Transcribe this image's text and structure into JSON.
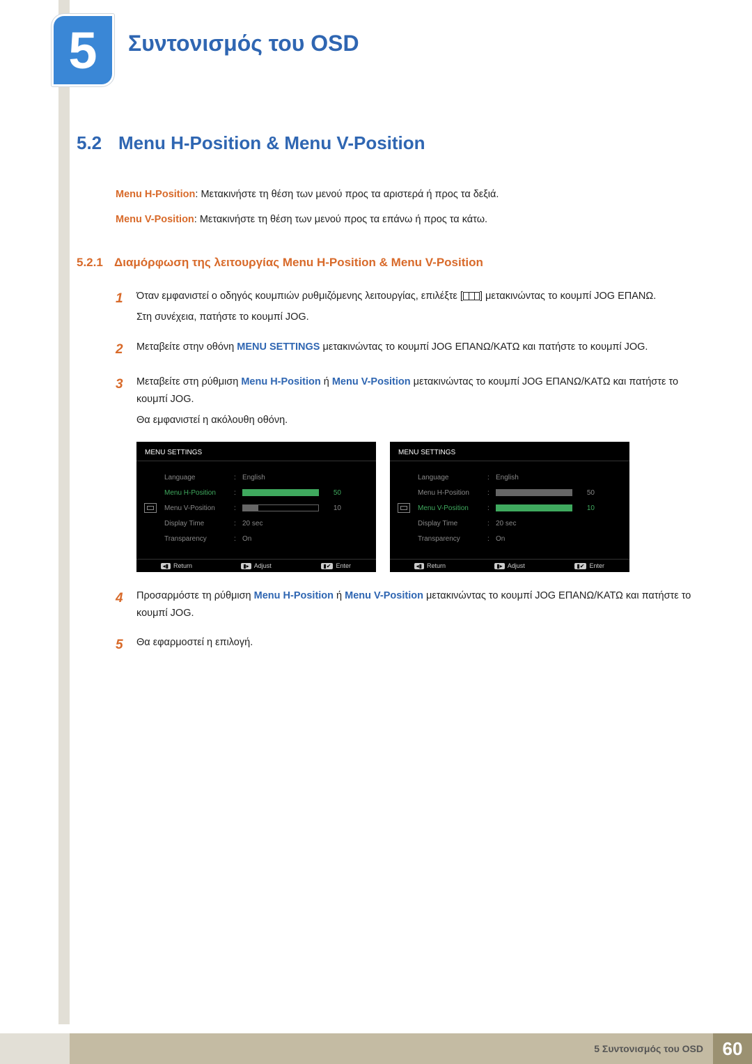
{
  "chapter": {
    "number": "5",
    "title": "Συντονισμός του OSD"
  },
  "section": {
    "number": "5.2",
    "title": "Menu H-Position & Menu V-Position",
    "h_def_term": "Menu H-Position",
    "h_def_text": ": Μετακινήστε τη θέση των μενού προς τα αριστερά ή προς τα δεξιά.",
    "v_def_term": "Menu V-Position",
    "v_def_text": ": Μετακινήστε τη θέση των μενού προς τα επάνω ή προς τα κάτω."
  },
  "subsection": {
    "number": "5.2.1",
    "title": "Διαμόρφωση της λειτουργίας Menu H-Position & Menu V-Position"
  },
  "steps": {
    "s1a": "Όταν εμφανιστεί ο οδηγός κουμπιών ρυθμιζόμενης λειτουργίας, επιλέξτε [",
    "s1b": "] μετακινώντας το κουμπί JOG ΕΠΑΝΩ.",
    "s1c": "Στη συνέχεια, πατήστε το κουμπί JOG.",
    "s2a": "Μεταβείτε στην οθόνη ",
    "s2_strong": "MENU SETTINGS",
    "s2b": " μετακινώντας το κουμπί JOG ΕΠΑΝΩ/ΚΑΤΩ και πατήστε το κουμπί JOG.",
    "s3a": "Μεταβείτε στη ρύθμιση ",
    "s3_h": "Menu H-Position",
    "s3_or": " ή ",
    "s3_v": "Menu V-Position",
    "s3b": " μετακινώντας το κουμπί JOG ΕΠΑΝΩ/ΚΑΤΩ και πατήστε το κουμπί JOG.",
    "s3c": "Θα εμφανιστεί η ακόλουθη οθόνη.",
    "s4a": "Προσαρμόστε τη ρύθμιση ",
    "s4_h": "Menu H-Position",
    "s4_or": " ή ",
    "s4_v": "Menu V-Position",
    "s4b": " μετακινώντας το κουμπί JOG ΕΠΑΝΩ/ΚΑΤΩ και πατήστε το κουμπί JOG.",
    "s5": "Θα εφαρμοστεί η επιλογή.",
    "n1": "1",
    "n2": "2",
    "n3": "3",
    "n4": "4",
    "n5": "5"
  },
  "osd": {
    "title": "MENU SETTINGS",
    "rows": {
      "language": {
        "label": "Language",
        "value": "English"
      },
      "hpos": {
        "label": "Menu H-Position",
        "value": "50",
        "fill": "100%"
      },
      "vpos": {
        "label": "Menu V-Position",
        "value": "10",
        "fill": "20%"
      },
      "display": {
        "label": "Display Time",
        "value": "20 sec"
      },
      "trans": {
        "label": "Transparency",
        "value": "On"
      }
    },
    "footer": {
      "return": "Return",
      "adjust": "Adjust",
      "enter": "Enter"
    }
  },
  "footer": {
    "text": "5 Συντονισμός του OSD",
    "page": "60"
  }
}
